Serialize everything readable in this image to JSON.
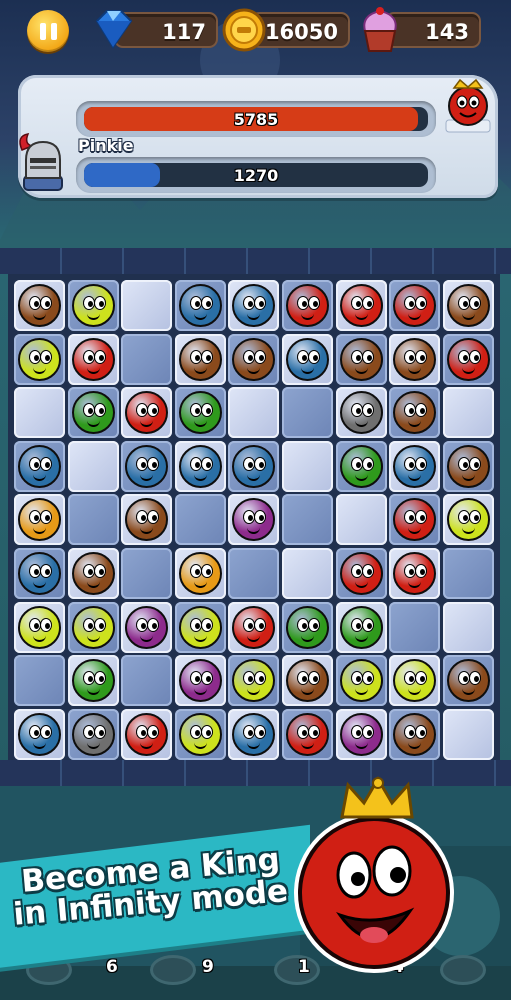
{
  "hud": {
    "gems": "117",
    "coins": "16050",
    "cupcakes": "143"
  },
  "battle": {
    "enemy_hp": "5785",
    "enemy_hp_fraction": 0.97,
    "player_name": "Pinkie",
    "player_hp": "1270",
    "player_hp_fraction": 0.22
  },
  "colors": {
    "brown": "#8a4a1c",
    "yellow": "#cde21d",
    "blue": "#2a6fa6",
    "red": "#d01f14",
    "green": "#2f9a1c",
    "gray": "#6f6f6f",
    "purple": "#8d2b8c",
    "orange": "#e79a17",
    "enemy_bar": "#d63c17",
    "player_bar": "#2f69c6"
  },
  "board": {
    "legend": "tile codes: L=light ice, D=dark ice; monsters: br,ye,bl,re,gr,ga,pu,or",
    "rows": [
      [
        "br",
        "ye",
        "L",
        "bl",
        "bl",
        "re",
        "re",
        "re",
        "br"
      ],
      [
        "ye",
        "re",
        "D",
        "br",
        "br",
        "bl",
        "br",
        "br",
        "re"
      ],
      [
        "L",
        "gr",
        "re",
        "gr",
        "L",
        "D",
        "ga",
        "br",
        "L"
      ],
      [
        "bl",
        "L",
        "bl",
        "bl",
        "bl",
        "L",
        "gr",
        "bl",
        "br"
      ],
      [
        "or",
        "D",
        "br",
        "D",
        "pu",
        "D",
        "L",
        "re",
        "ye"
      ],
      [
        "bl",
        "br",
        "D",
        "or",
        "D",
        "L",
        "re",
        "re",
        "D"
      ],
      [
        "ye",
        "ye",
        "pu",
        "ye",
        "re",
        "gr",
        "gr",
        "D",
        "L"
      ],
      [
        "D",
        "gr",
        "D",
        "pu",
        "ye",
        "br",
        "ye",
        "ye",
        "br"
      ],
      [
        "bl",
        "ga",
        "re",
        "ye",
        "bl",
        "re",
        "pu",
        "br",
        "L"
      ]
    ]
  },
  "promo": {
    "line1": "Become a King",
    "line2": "in Infinity mode"
  },
  "counters": [
    "6",
    "9",
    "1",
    "4"
  ],
  "icons": {
    "pause": "pause-icon",
    "gem": "gem-icon",
    "coin": "coin-icon",
    "cupcake": "cupcake-icon",
    "knight": "knight-avatar",
    "enemy": "red-monster-avatar",
    "mascot": "crowned-red-monster"
  }
}
